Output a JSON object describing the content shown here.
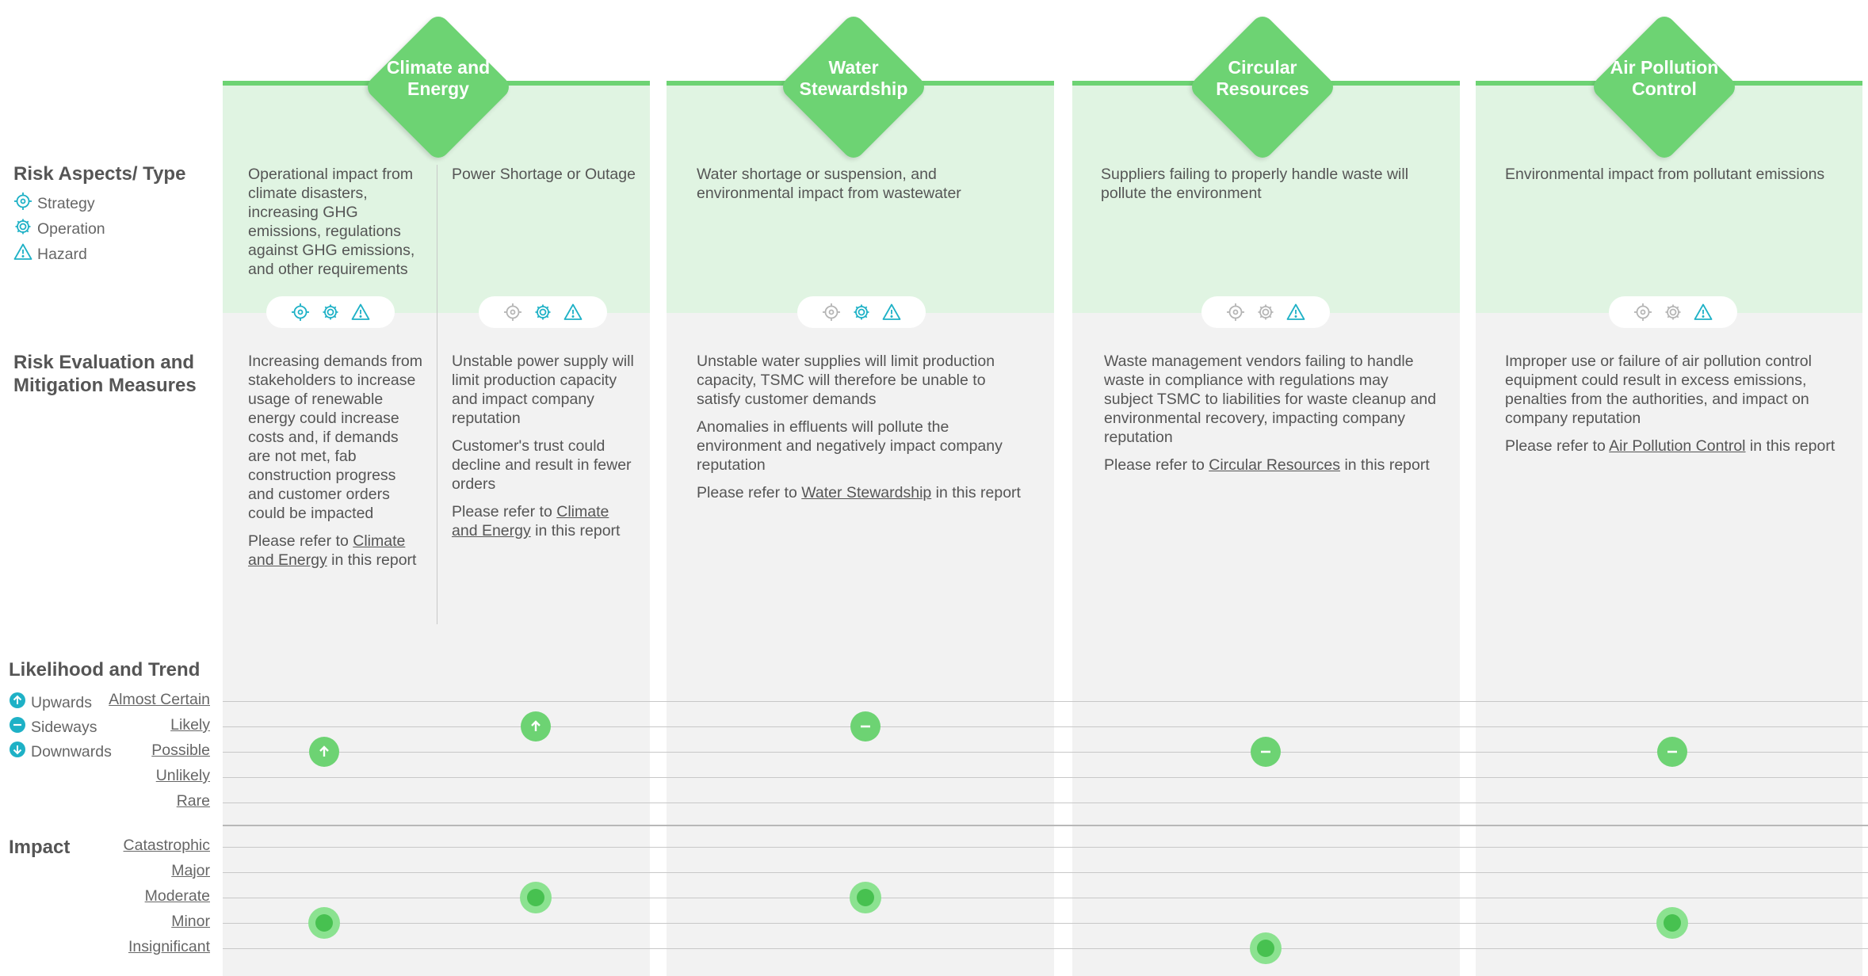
{
  "left_panel": {
    "risk_aspects_heading": "Risk Aspects/ Type",
    "aspect_legend": [
      {
        "label": "Strategy",
        "icon": "strategy-target-icon"
      },
      {
        "label": "Operation",
        "icon": "operation-gear-icon"
      },
      {
        "label": "Hazard",
        "icon": "hazard-warning-icon"
      }
    ],
    "evaluation_heading_line1": "Risk Evaluation and",
    "evaluation_heading_line2": "Mitigation Measures",
    "likelihood_heading": "Likelihood and Trend",
    "trend_legend": [
      {
        "label": "Upwards",
        "icon": "arrow-up-icon"
      },
      {
        "label": "Sideways",
        "icon": "minus-icon"
      },
      {
        "label": "Downwards",
        "icon": "arrow-down-icon"
      }
    ],
    "likelihood_levels": [
      "Almost Certain",
      "Likely",
      "Possible",
      "Unlikely",
      "Rare"
    ],
    "impact_heading": "Impact",
    "impact_levels": [
      "Catastrophic",
      "Major",
      "Moderate",
      "Minor",
      "Insignificant"
    ]
  },
  "columns": [
    {
      "title_line1": "Climate and",
      "title_line2": "Energy",
      "subcolumns": [
        {
          "aspect": "Operational impact from climate disasters, increasing GHG emissions, regulations against GHG emissions, and other requirements",
          "active_types": [
            "strategy",
            "operation",
            "hazard"
          ],
          "paragraphs": [
            "Increasing demands from stakeholders to increase usage of renewable energy could increase costs and, if demands are not met, fab construction progress and customer orders could be impacted"
          ],
          "refer_prefix": "Please refer to ",
          "refer_link": "Climate and Energy",
          "refer_suffix": " in this report",
          "likelihood": "Possible",
          "trend": "Upwards",
          "impact": "Minor"
        },
        {
          "aspect": "Power Shortage or Outage",
          "active_types": [
            "operation",
            "hazard"
          ],
          "paragraphs": [
            "Unstable power supply will limit production capacity and impact company reputation",
            "Customer's trust could decline and result in fewer orders"
          ],
          "refer_prefix": "Please refer to ",
          "refer_link": "Climate and Energy",
          "refer_suffix": " in this report",
          "likelihood": "Likely",
          "trend": "Upwards",
          "impact": "Moderate"
        }
      ]
    },
    {
      "title_line1": "Water",
      "title_line2": "Stewardship",
      "aspect": "Water shortage or suspension, and environmental impact from wastewater",
      "active_types": [
        "operation",
        "hazard"
      ],
      "paragraphs": [
        "Unstable water supplies will limit production capacity, TSMC will therefore be unable to satisfy customer demands",
        "Anomalies in effluents will pollute the environment and negatively impact company reputation"
      ],
      "refer_prefix": "Please refer to ",
      "refer_link": "Water Stewardship",
      "refer_suffix": " in this report",
      "likelihood": "Likely",
      "trend": "Sideways",
      "impact": "Moderate"
    },
    {
      "title_line1": "Circular",
      "title_line2": "Resources",
      "aspect": "Suppliers failing to properly handle waste will pollute the environment",
      "active_types": [
        "hazard"
      ],
      "paragraphs": [
        "Waste management vendors failing to handle waste in compliance with regulations may subject TSMC to liabilities for waste cleanup and environmental recovery, impacting company reputation"
      ],
      "refer_prefix": "Please refer to ",
      "refer_link": "Circular Resources",
      "refer_suffix": " in this report",
      "likelihood": "Possible",
      "trend": "Sideways",
      "impact": "Insignificant"
    },
    {
      "title_line1": "Air Pollution",
      "title_line2": "Control",
      "aspect": "Environmental impact from pollutant emissions",
      "active_types": [
        "hazard"
      ],
      "paragraphs": [
        "Improper use or failure of air pollution control equipment could result in excess emissions, penalties from the authorities, and impact on company reputation"
      ],
      "refer_prefix": "Please refer to ",
      "refer_link": "Air Pollution Control",
      "refer_suffix": " in this report",
      "likelihood": "Possible",
      "trend": "Sideways",
      "impact": "Minor"
    }
  ],
  "colors": {
    "accent_green": "#6dd373",
    "light_green_band": "#e0f4e2",
    "panel_gray": "#f2f2f2",
    "icon_teal": "#1eb1c6",
    "icon_inactive": "#b5b5b5"
  }
}
